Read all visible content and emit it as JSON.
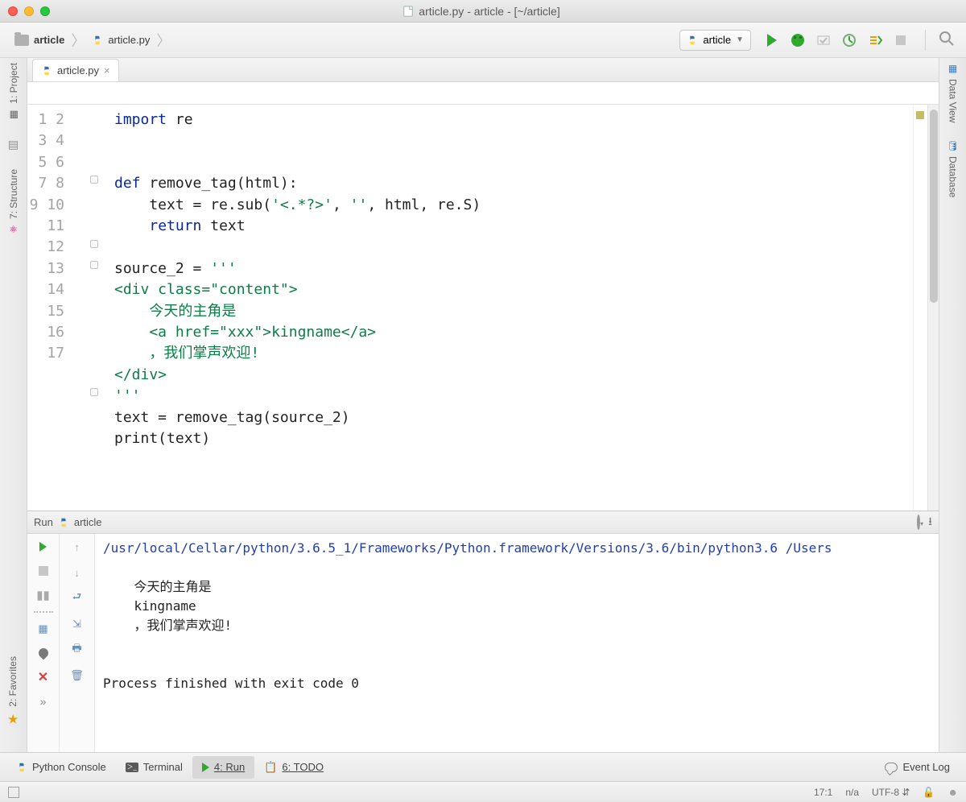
{
  "titlebar": {
    "title": "article.py - article - [~/article]"
  },
  "breadcrumb": {
    "project": "article",
    "file": "article.py"
  },
  "run_config": {
    "name": "article"
  },
  "editor_tab": {
    "name": "article.py"
  },
  "left_tools": {
    "project": "1: Project",
    "structure": "7: Structure",
    "favorites": "2: Favorites"
  },
  "right_tools": {
    "dataview": "Data View",
    "database": "Database"
  },
  "gutter": [
    "1",
    "2",
    "3",
    "4",
    "5",
    "6",
    "7",
    "8",
    "9",
    "10",
    "11",
    "12",
    "13",
    "14",
    "15",
    "16",
    "17"
  ],
  "code": {
    "l1a": "import",
    "l1b": " re",
    "l4a": "def ",
    "l4b": "remove_tag(html):",
    "l5a": "    text = re.sub(",
    "l5b": "'<.*?>'",
    "l5c": ", ",
    "l5d": "''",
    "l5e": ", html, re.S)",
    "l6a": "    ",
    "l6b": "return",
    "l6c": " text",
    "l8a": "source_2 = ",
    "l8b": "'''",
    "l9": "<div class=\"content\">",
    "l10": "    今天的主角是",
    "l11": "    <a href=\"xxx\">kingname</a>",
    "l12": "    ，我们掌声欢迎!",
    "l13": "</div>",
    "l14": "'''",
    "l15": "text = remove_tag(source_2)",
    "l16": "print(text)"
  },
  "run_panel": {
    "title": "Run",
    "config": "article",
    "cmd": "/usr/local/Cellar/python/3.6.5_1/Frameworks/Python.framework/Versions/3.6/bin/python3.6 /Users",
    "out1": "    今天的主角是",
    "out2": "    kingname",
    "out3": "    ，我们掌声欢迎!",
    "exitmsg": "Process finished with exit code 0"
  },
  "bottom": {
    "pyconsole": "Python Console",
    "terminal": "Terminal",
    "run": "4: Run",
    "todo": "6: TODO",
    "eventlog": "Event Log"
  },
  "status": {
    "pos": "17:1",
    "na": "n/a",
    "enc": "UTF-8"
  }
}
